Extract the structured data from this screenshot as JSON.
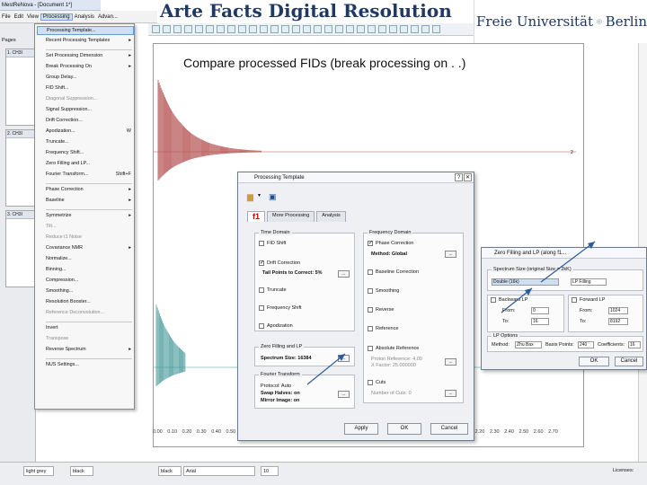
{
  "app": {
    "window_title": "MestReNova - [Document 1*]",
    "menus": [
      "File",
      "Edit",
      "View",
      "Processing",
      "Analysis",
      "Advan..."
    ],
    "active_menu": "Processing"
  },
  "slide": {
    "title": "Arte Facts Digital Resolution",
    "subtitle": "Compare  processed FIDs (break processing on . .)",
    "logo_left": "Freie Universität",
    "logo_right": "Berlin"
  },
  "left_panel": {
    "tab": "Pages",
    "fids": [
      "1. CH3I",
      "2. CH3I",
      "3. CH3I"
    ]
  },
  "processing_menu": [
    {
      "label": "Processing Template...",
      "highlight": true
    },
    {
      "label": "Recent Processing Templates",
      "submenu": true
    },
    {
      "sep": true
    },
    {
      "label": "Set Processing Dimension",
      "submenu": true
    },
    {
      "label": "Break Processing On",
      "submenu": true
    },
    {
      "label": "Group Delay..."
    },
    {
      "label": "FID Shift..."
    },
    {
      "label": "Diagonal Suppression...",
      "disabled": true
    },
    {
      "label": "Signal Suppression..."
    },
    {
      "label": "Drift Correction..."
    },
    {
      "label": "Apodization...",
      "shortcut": "W"
    },
    {
      "label": "Truncate..."
    },
    {
      "label": "Frequency Shift..."
    },
    {
      "label": "Zero Filling and LP..."
    },
    {
      "label": "Fourier Transform...",
      "shortcut": "Shift+F"
    },
    {
      "sep": true
    },
    {
      "label": "Phase Correction",
      "submenu": true
    },
    {
      "label": "Baseline",
      "submenu": true
    },
    {
      "sep": true
    },
    {
      "label": "Symmetrize",
      "submenu": true
    },
    {
      "label": "Tilt...",
      "disabled": true
    },
    {
      "label": "Reduce t1 Noise",
      "disabled": true
    },
    {
      "label": "Covariance NMR",
      "submenu": true
    },
    {
      "label": "Normalize..."
    },
    {
      "label": "Binning..."
    },
    {
      "label": "Compression..."
    },
    {
      "label": "Smoothing..."
    },
    {
      "label": "Resolution Booster..."
    },
    {
      "label": "Reference Deconvolution...",
      "disabled": true
    },
    {
      "sep": true
    },
    {
      "label": "Invert"
    },
    {
      "label": "Transpose",
      "disabled": true
    },
    {
      "label": "Reverse Spectrum",
      "submenu": true
    },
    {
      "sep": true
    },
    {
      "label": "NUS Settings..."
    }
  ],
  "dialog": {
    "title": "Processing Template",
    "tabs": [
      "f1",
      "More Processing",
      "Analysis"
    ],
    "time_domain": {
      "label": "Time Domain",
      "fid_shift": "FID Shift",
      "drift_correction": "Drift Correction",
      "tail_points": "Tail Points to Correct: 5%",
      "truncate": "Truncate",
      "frequency_shift": "Frequency Shift",
      "apodization": "Apodization"
    },
    "zero_filling": {
      "label": "Zero Filling and LP",
      "spectrum_size": "Spectrum Size: 16384"
    },
    "fourier": {
      "label": "Fourier Transform",
      "protocol": "Protocol: Auto",
      "swap_halves": "Swap Halves: on",
      "mirror_image": "Mirror Image: on"
    },
    "freq_domain": {
      "label": "Frequency Domain",
      "phase_correction": "Phase Correction",
      "method": "Method: Global",
      "baseline_correction": "Baseline Correction",
      "smoothing": "Smoothing",
      "reverse": "Reverse",
      "reference": "Reference",
      "absolute_reference": "Absolute Reference",
      "proton_reference": "Proton Reference: 4.00",
      "x_factor": "X Factor: 25.000000",
      "cuts": "Cuts",
      "number_of_cuts": "Number of Cuts: 0"
    },
    "buttons": {
      "apply": "Apply",
      "ok": "OK",
      "cancel": "Cancel"
    }
  },
  "dialog2": {
    "title": "Zero Filling and LP (along f1...",
    "spectrum_size_label": "Spectrum Size (original Size = 2kK)",
    "size_value": "Double (16k)",
    "lp_filling": "LP Filling",
    "backward_lp": "Backward LP",
    "forward_lp": "Forward LP",
    "from_label": "From:",
    "to_label": "To:",
    "from_val": "0",
    "to_val": "16",
    "to_val2": "256",
    "fwd_from": "1024",
    "fwd_to": "8192",
    "lp_options": "LP Options",
    "method": "Method:",
    "method_val": "Zhu Bax",
    "basis_points": "Basis Points:",
    "basis_val": "240",
    "coefficients": "Coefficients:",
    "coef_val": "16",
    "ok": "OK",
    "cancel": "Cancel"
  },
  "axis": {
    "ticks": [
      "0.00",
      "0.10",
      "0.20",
      "0.30",
      "0.40",
      "0.50",
      "0.60",
      "0.70",
      "0.80",
      "0.90",
      "1.00",
      "1.10",
      "1.20",
      "1.30",
      "1.40",
      "1.50",
      "1.60",
      "1.70",
      "1.80",
      "1.90",
      "2.00",
      "2.10",
      "2.20",
      "2.30",
      "2.40",
      "2.50",
      "2.60",
      "2.70"
    ]
  },
  "plot": {
    "label2": "2"
  },
  "bottombar": {
    "color": "light grey",
    "color2": "black",
    "font": "Arial",
    "size": "10",
    "licenses": "Licenses:",
    "zoom": "0/3"
  }
}
